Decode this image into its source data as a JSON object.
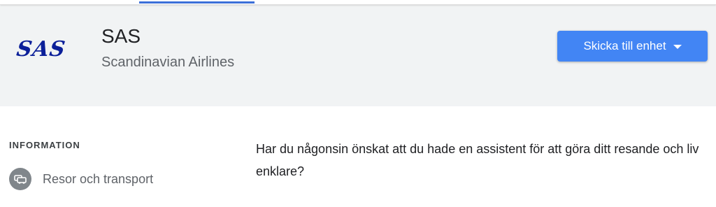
{
  "app": {
    "logo_text": "SAS",
    "title": "SAS",
    "subtitle": "Scandinavian Airlines"
  },
  "actions": {
    "send_label": "Skicka till enhet"
  },
  "info": {
    "section_label": "INFORMATION",
    "category_label": "Resor och transport",
    "category_icon": "car-icon"
  },
  "description": "Har du någonsin önskat att du hade en assistent för att göra ditt resande och liv enklare?",
  "colors": {
    "accent": "#4285f4",
    "tab_indicator": "#3b6fd8",
    "logo": "#0b1f99",
    "header_bg": "#f1f3f4"
  }
}
